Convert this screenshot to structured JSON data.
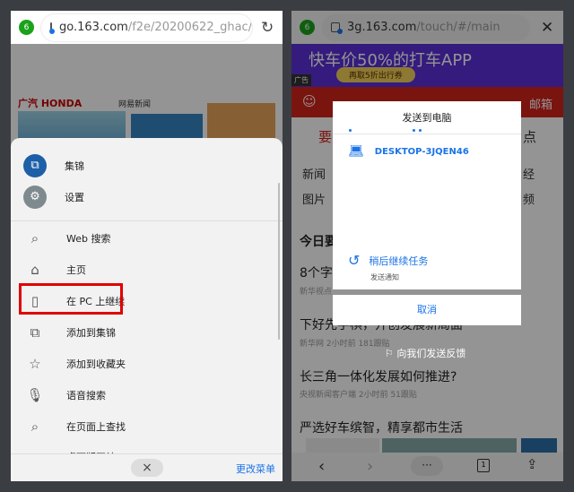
{
  "left": {
    "tab_count": "6",
    "url_host": "go.163.com",
    "url_path": "/f2e/20200622_ghac/i...",
    "ad_brand": "广汽 HONDA",
    "ad_partner": "网易新闻",
    "menu_top": [
      {
        "label": "集锦",
        "icon": "collections-icon"
      },
      {
        "label": "设置",
        "icon": "gear-icon"
      }
    ],
    "menu_items": [
      {
        "label": "Web 搜索",
        "icon": "search-icon"
      },
      {
        "label": "主页",
        "icon": "home-icon"
      },
      {
        "label": "在 PC 上继续",
        "icon": "continue-on-pc-icon",
        "highlighted": true
      },
      {
        "label": "添加到集锦",
        "icon": "add-collection-icon"
      },
      {
        "label": "添加到收藏夹",
        "icon": "add-favorite-icon"
      },
      {
        "label": "语音搜索",
        "icon": "microphone-icon"
      },
      {
        "label": "在页面上查找",
        "icon": "find-in-page-icon"
      },
      {
        "label": "桌面版网站",
        "icon": "desktop-site-icon"
      }
    ],
    "close_label": "×",
    "change_menu": "更改菜单",
    "highlight_color": "#e00000"
  },
  "right": {
    "tab_count": "6",
    "url_host": "3g.163.com",
    "url_path": "/touch/#/main",
    "banner_text": "快车价50%的打车APP",
    "banner_button": "再取5折出行券",
    "ad_label": "广告",
    "mail": "邮箱",
    "tabs": [
      "要",
      "点"
    ],
    "nav_row1": [
      "新闻",
      "经"
    ],
    "nav_row2": [
      "图片",
      "频"
    ],
    "section": "今日要",
    "news": [
      {
        "title": "8个字",
        "source": "新华视点"
      },
      {
        "title": "下好先手棋，开创发展新局面",
        "source": "新华网  2小时前  181跟贴"
      },
      {
        "title": "长三角一体化发展如何推进?",
        "source": "央视新闻客户端  2小时前  51跟贴"
      },
      {
        "title": "严选好车缤智，精享都市生活",
        "source": ""
      }
    ],
    "dialog": {
      "title": "发送到电脑",
      "device": "DESKTOP-3JQEN46",
      "later": "稍后继续任务",
      "later_sub": "发送通知",
      "cancel": "取消"
    },
    "feedback": "向我们发送反馈",
    "tab_number": "1",
    "accent": "#1a73e8"
  }
}
